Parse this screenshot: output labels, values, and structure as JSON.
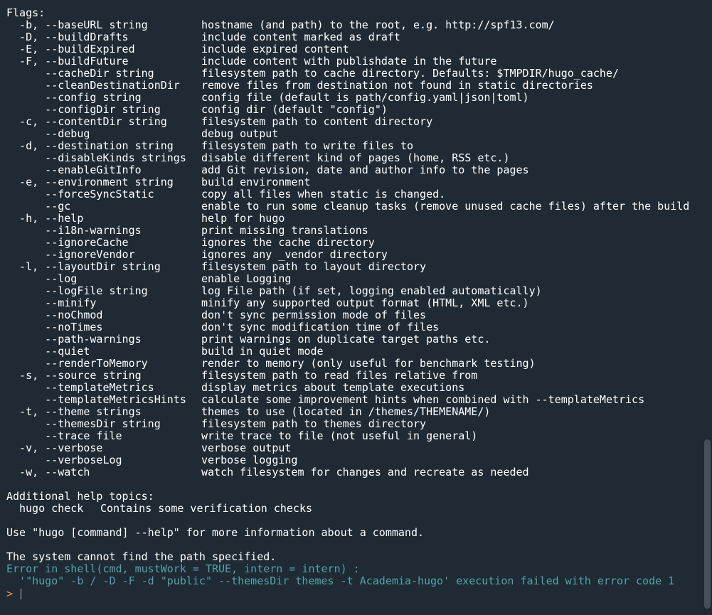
{
  "console": {
    "flags_heading": "Flags:",
    "flags": [
      {
        "option": "  -b, --baseURL string",
        "description": "hostname (and path) to the root, e.g. http://spf13.com/"
      },
      {
        "option": "  -D, --buildDrafts",
        "description": "include content marked as draft"
      },
      {
        "option": "  -E, --buildExpired",
        "description": "include expired content"
      },
      {
        "option": "  -F, --buildFuture",
        "description": "include content with publishdate in the future"
      },
      {
        "option": "      --cacheDir string",
        "description": "filesystem path to cache directory. Defaults: $TMPDIR/hugo_cache/"
      },
      {
        "option": "      --cleanDestinationDir",
        "description": "remove files from destination not found in static directories"
      },
      {
        "option": "      --config string",
        "description": "config file (default is path/config.yaml|json|toml)"
      },
      {
        "option": "      --configDir string",
        "description": "config dir (default \"config\")"
      },
      {
        "option": "  -c, --contentDir string",
        "description": "filesystem path to content directory"
      },
      {
        "option": "      --debug",
        "description": "debug output"
      },
      {
        "option": "  -d, --destination string",
        "description": "filesystem path to write files to"
      },
      {
        "option": "      --disableKinds strings",
        "description": "disable different kind of pages (home, RSS etc.)"
      },
      {
        "option": "      --enableGitInfo",
        "description": "add Git revision, date and author info to the pages"
      },
      {
        "option": "  -e, --environment string",
        "description": "build environment"
      },
      {
        "option": "      --forceSyncStatic",
        "description": "copy all files when static is changed."
      },
      {
        "option": "      --gc",
        "description": "enable to run some cleanup tasks (remove unused cache files) after the build"
      },
      {
        "option": "  -h, --help",
        "description": "help for hugo"
      },
      {
        "option": "      --i18n-warnings",
        "description": "print missing translations"
      },
      {
        "option": "      --ignoreCache",
        "description": "ignores the cache directory"
      },
      {
        "option": "      --ignoreVendor",
        "description": "ignores any _vendor directory"
      },
      {
        "option": "  -l, --layoutDir string",
        "description": "filesystem path to layout directory"
      },
      {
        "option": "      --log",
        "description": "enable Logging"
      },
      {
        "option": "      --logFile string",
        "description": "log File path (if set, logging enabled automatically)"
      },
      {
        "option": "      --minify",
        "description": "minify any supported output format (HTML, XML etc.)"
      },
      {
        "option": "      --noChmod",
        "description": "don't sync permission mode of files"
      },
      {
        "option": "      --noTimes",
        "description": "don't sync modification time of files"
      },
      {
        "option": "      --path-warnings",
        "description": "print warnings on duplicate target paths etc."
      },
      {
        "option": "      --quiet",
        "description": "build in quiet mode"
      },
      {
        "option": "      --renderToMemory",
        "description": "render to memory (only useful for benchmark testing)"
      },
      {
        "option": "  -s, --source string",
        "description": "filesystem path to read files relative from"
      },
      {
        "option": "      --templateMetrics",
        "description": "display metrics about template executions"
      },
      {
        "option": "      --templateMetricsHints",
        "description": "calculate some improvement hints when combined with --templateMetrics"
      },
      {
        "option": "  -t, --theme strings",
        "description": "themes to use (located in /themes/THEMENAME/)"
      },
      {
        "option": "      --themesDir string",
        "description": "filesystem path to themes directory"
      },
      {
        "option": "      --trace file",
        "description": "write trace to file (not useful in general)"
      },
      {
        "option": "  -v, --verbose",
        "description": "verbose output"
      },
      {
        "option": "      --verboseLog",
        "description": "verbose logging"
      },
      {
        "option": "  -w, --watch",
        "description": "watch filesystem for changes and recreate as needed"
      }
    ],
    "help_topics_heading": "Additional help topics:",
    "help_topic": {
      "name": "hugo check",
      "description": "Contains some verification checks"
    },
    "usage_line": "Use \"hugo [command] --help\" for more information about a command.",
    "system_message": "The system cannot find the path specified.",
    "error_line_1": "Error in shell(cmd, mustWork = TRUE, intern = intern) :",
    "error_line_2": "  '\"hugo\" -b / -D -F -d \"public\" --themesDir themes -t Academia-hugo' execution failed with error code 1",
    "prompt": "> "
  },
  "colors": {
    "background": "#1f2a35",
    "text": "#ffffff",
    "error_text": "#52a3a9",
    "prompt": "#e8964a"
  }
}
